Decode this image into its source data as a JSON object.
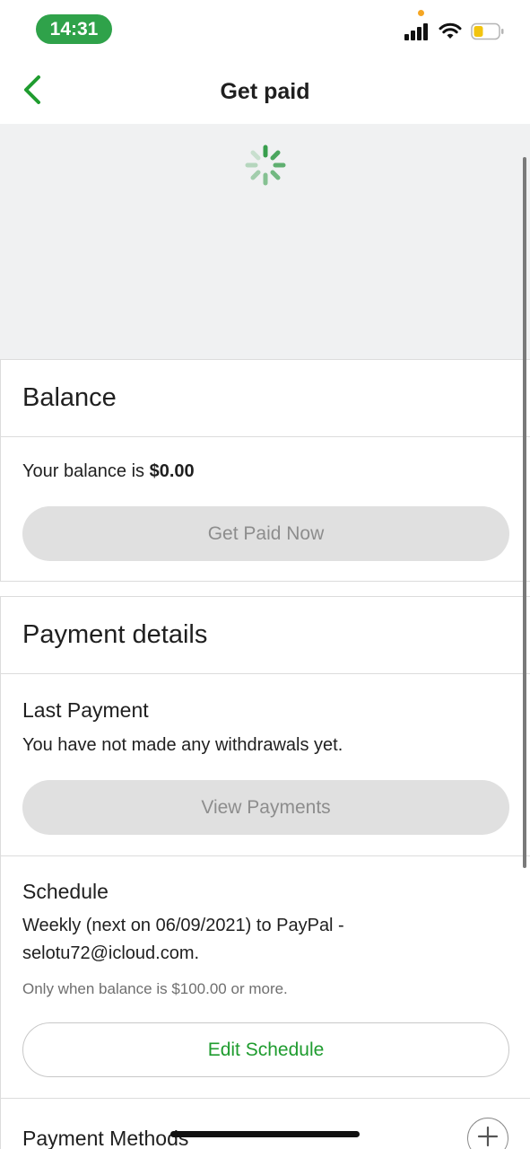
{
  "status_bar": {
    "time": "14:31",
    "icons": [
      "cellular-signal-icon",
      "wifi-icon",
      "battery-icon"
    ],
    "privacy_indicator_color": "#f5a623",
    "time_pill_color": "#2fa24a"
  },
  "nav": {
    "title": "Get paid",
    "back_icon": "chevron-left-icon",
    "accent_color": "#1f9c2f"
  },
  "loading": {
    "icon": "loading-spinner-icon"
  },
  "balance": {
    "header": "Balance",
    "text_prefix": "Your balance is ",
    "amount": "$0.00",
    "button_label": "Get Paid Now"
  },
  "payment_details": {
    "header": "Payment details",
    "last_payment": {
      "title": "Last Payment",
      "text": "You have not made any withdrawals yet.",
      "button_label": "View Payments"
    },
    "schedule": {
      "title": "Schedule",
      "line1": "Weekly (next on 06/09/2021) to PayPal -",
      "line2": "selotu72@icloud.com.",
      "note": "Only when balance is $100.00 or more.",
      "button_label": "Edit Schedule"
    },
    "payment_methods": {
      "title": "Payment Methods",
      "add_icon": "plus-icon"
    }
  }
}
